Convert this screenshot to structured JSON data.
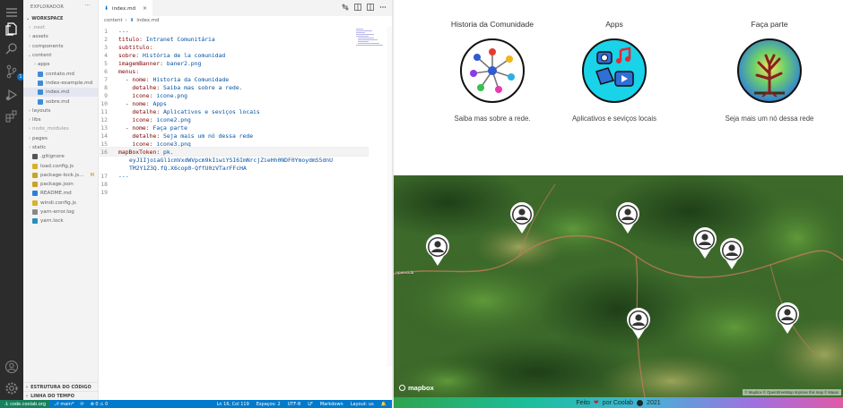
{
  "vscode": {
    "sidebar": {
      "title": "EXPLORADOR",
      "more": "···",
      "workspace": "WORKSPACE",
      "items": [
        {
          "label": ".next",
          "type": "folder",
          "chevron": "›",
          "dim": true
        },
        {
          "label": "assets",
          "type": "folder",
          "chevron": "›"
        },
        {
          "label": "components",
          "type": "folder",
          "chevron": "›"
        },
        {
          "label": "content",
          "type": "folder",
          "chevron": "⌄"
        },
        {
          "label": "apps",
          "type": "folder",
          "chevron": "›",
          "indent": 1
        },
        {
          "label": "contato.md",
          "type": "md",
          "indent": 1
        },
        {
          "label": "index-example.md",
          "type": "md",
          "indent": 1
        },
        {
          "label": "index.md",
          "type": "md",
          "indent": 1,
          "selected": true
        },
        {
          "label": "sobre.md",
          "type": "md",
          "indent": 1
        },
        {
          "label": "layouts",
          "type": "folder",
          "chevron": "›"
        },
        {
          "label": "libs",
          "type": "folder",
          "chevron": "›"
        },
        {
          "label": "node_modules",
          "type": "folder",
          "chevron": "›",
          "dim": true
        },
        {
          "label": "pages",
          "type": "folder",
          "chevron": "›"
        },
        {
          "label": "static",
          "type": "folder",
          "chevron": "›"
        },
        {
          "label": ".gitignore",
          "type": "git"
        },
        {
          "label": "load.config.js",
          "type": "js"
        },
        {
          "label": "package-lock.js...",
          "type": "json",
          "badge": "M"
        },
        {
          "label": "package.json",
          "type": "json"
        },
        {
          "label": "README.md",
          "type": "info"
        },
        {
          "label": "windi.config.js",
          "type": "js"
        },
        {
          "label": "yarn-error.log",
          "type": "log"
        },
        {
          "label": "yarn.lock",
          "type": "yarn"
        }
      ],
      "bottom_sections": [
        "ESTRUTURA DO CÓDIGO",
        "LINHA DO TEMPO"
      ]
    },
    "tab": {
      "label": "index.md",
      "close": "×"
    },
    "breadcrumb": [
      "content",
      "›",
      "index.md"
    ],
    "code_lines": [
      {
        "n": "1",
        "text": "---"
      },
      {
        "n": "2",
        "key": "titulo:",
        "val": " Intranet Comunitária"
      },
      {
        "n": "3",
        "key": "subtitulo:",
        "val": ""
      },
      {
        "n": "4",
        "key": "sobre:",
        "val": " História de la comunidad"
      },
      {
        "n": "5",
        "key": "imagemBanner:",
        "val": " baner2.png"
      },
      {
        "n": "6",
        "key": "menus:",
        "val": ""
      },
      {
        "n": "7",
        "key": "  - nome:",
        "val": " Historia da Comunidade"
      },
      {
        "n": "8",
        "key": "    detalhe:",
        "val": " Saiba mas sobre a rede."
      },
      {
        "n": "9",
        "key": "    icone:",
        "val": " icone.png"
      },
      {
        "n": "10",
        "key": "  - nome:",
        "val": " Apps"
      },
      {
        "n": "11",
        "key": "    detalhe:",
        "val": " Aplicativos e seviços locais"
      },
      {
        "n": "12",
        "key": "    icone:",
        "val": " icone2.png"
      },
      {
        "n": "13",
        "key": "  - nome:",
        "val": " Faça parte"
      },
      {
        "n": "14",
        "key": "    detalhe:",
        "val": " Seja mais um nó dessa rede"
      },
      {
        "n": "15",
        "key": "    icone:",
        "val": " icone3.png"
      },
      {
        "n": "16",
        "key": "mapBoxToken:",
        "val": " pk."
      },
      {
        "n": "17",
        "text": "---"
      },
      {
        "n": "18",
        "text": ""
      },
      {
        "n": "19",
        "text": ""
      }
    ],
    "token_lines": [
      "eyJ1IjoiaGl1cmVxdWVpcm9kIiwiYSI6ImNrcjZieHh0NDF0YmoydmS5dnU",
      "TM2Y1Z3Q.fQ.X6cop0-QffU0zVTarFFcHA"
    ],
    "status_bar": {
      "remote": "⚓ code.coolab.org",
      "left": [
        "⎇ main*",
        "⟳",
        "⊗ 0 ⚠ 0"
      ],
      "right": [
        "Ln 16, Col 119",
        "Espaços: 2",
        "UTF-8",
        "LF",
        "Markdown",
        "Layout: us",
        "🔔"
      ]
    }
  },
  "preview": {
    "cards": [
      {
        "title": "Historia da Comunidade",
        "desc": "Saiba mas sobre a rede."
      },
      {
        "title": "Apps",
        "desc": "Aplicativos e seviços locais"
      },
      {
        "title": "Faça parte",
        "desc": "Seja mais um nó dessa rede"
      }
    ],
    "map": {
      "logo": "mapbox",
      "attribution": "© Mapbox © OpenStreetMap Improve this map © Maxar",
      "place_label": "Aparecida"
    },
    "footer": {
      "prefix": "Feito",
      "heart": "❤",
      "middle": "por Coolab",
      "year": "2021"
    }
  }
}
